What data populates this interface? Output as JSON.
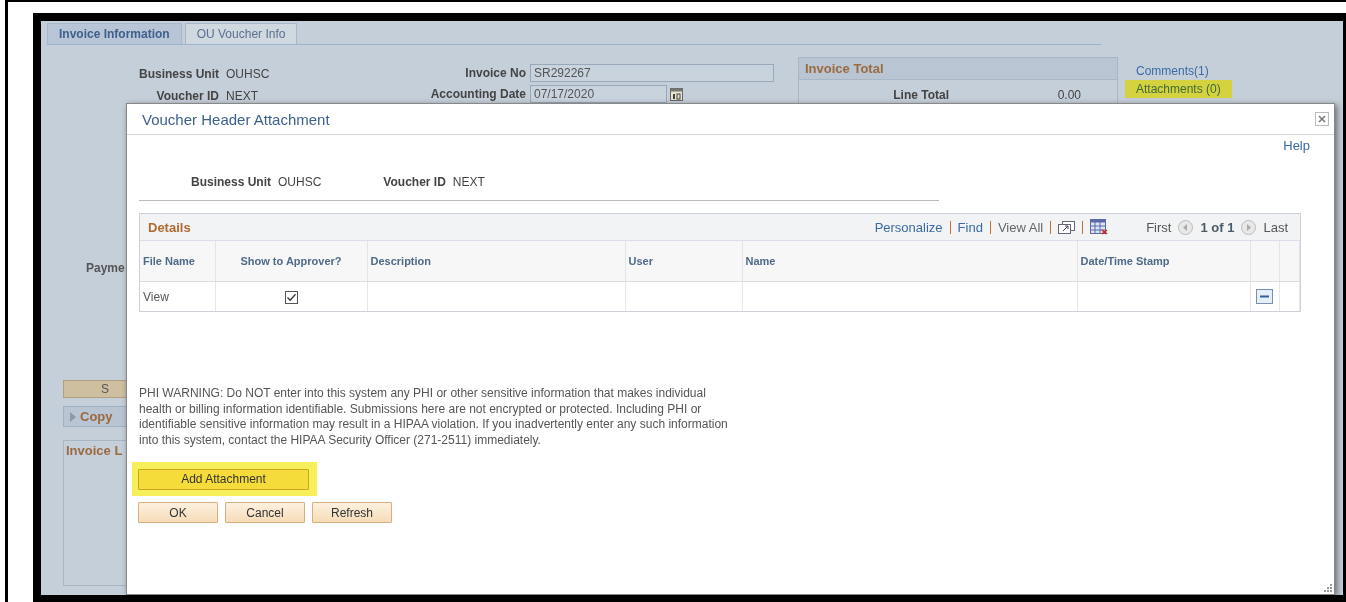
{
  "page_tabs": [
    {
      "label": "Invoice Information",
      "selected": true
    },
    {
      "label": "OU Voucher Info",
      "selected": false
    }
  ],
  "header_fields": [
    {
      "label": "Business Unit",
      "value": "OUHSC"
    },
    {
      "label": "Voucher ID",
      "value": "NEXT"
    }
  ],
  "invoice_fields": [
    {
      "label": "Invoice No",
      "value": "SR292267",
      "kind": "text"
    },
    {
      "label": "Accounting Date",
      "value": "07/17/2020",
      "kind": "date"
    }
  ],
  "invoice_total": {
    "title": "Invoice Total",
    "rows": [
      {
        "label": "Line Total",
        "value": "0.00"
      }
    ]
  },
  "links": [
    {
      "label": "Comments(1)",
      "highlighted": false
    },
    {
      "label": "Attachments (0)",
      "highlighted": true
    }
  ],
  "left_fragments": {
    "payment_label": "Payme",
    "button": "S",
    "collapsed_section": "Copy",
    "panel_title": "Invoice L"
  },
  "dialog": {
    "title": "Voucher Header Attachment",
    "help": "Help",
    "fields": [
      {
        "label": "Business Unit",
        "value": "OUHSC"
      },
      {
        "label": "Voucher ID",
        "value": "NEXT"
      }
    ],
    "grid": {
      "title": "Details",
      "nav_links": [
        {
          "label": "Personalize",
          "disabled": false
        },
        {
          "label": "Find",
          "disabled": false
        },
        {
          "label": "View All",
          "disabled": true
        }
      ],
      "pager": {
        "first": "First",
        "position": "1 of 1",
        "last": "Last"
      },
      "columns": [
        "File Name",
        "Show to Approver?",
        "Description",
        "User",
        "Name",
        "Date/Time Stamp"
      ],
      "rows": [
        {
          "file_name": "View",
          "show_to_approver": true
        }
      ]
    },
    "warning": "PHI WARNING: Do NOT enter into this system any PHI or other sensitive information that makes individual health or billing information identifiable. Submissions here are not encrypted or protected. Including PHI or identifiable sensitive information may result in a HIPAA violation. If you inadvertently enter any such information into this system, contact the HIPAA Security Officer (271-2511) immediately.",
    "buttons": [
      {
        "label": "Add Attachment",
        "highlighted": true
      },
      {
        "label": "OK",
        "highlighted": false
      },
      {
        "label": "Cancel",
        "highlighted": false
      },
      {
        "label": "Refresh",
        "highlighted": false
      }
    ]
  }
}
